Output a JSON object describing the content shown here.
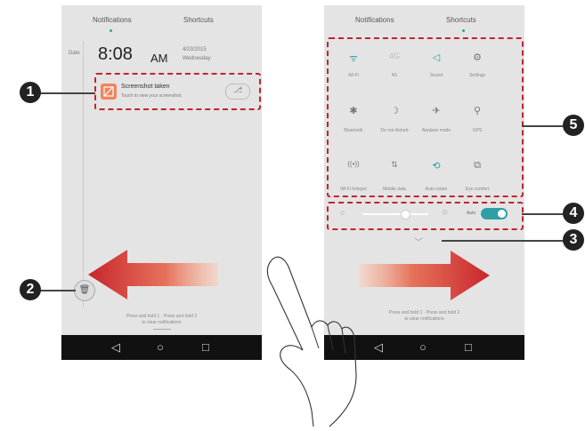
{
  "callouts": [
    "1",
    "2",
    "3",
    "4",
    "5"
  ],
  "left_screen": {
    "tabs": [
      "Notifications",
      "Shortcuts"
    ],
    "date_label": "Date",
    "time": "8:08",
    "ampm": "AM",
    "date_text": "4/23/2015",
    "weekday": "Wednesday",
    "notification_title": "Screenshot taken",
    "notification_text": "Touch to view your screenshot.",
    "bottom_text_1": "Press and hold 1 · Press and hold 2",
    "bottom_text_2": "to clear notifications"
  },
  "right_screen": {
    "tabs": [
      "Notifications",
      "Shortcuts"
    ],
    "row1": [
      {
        "icon": "wifi-icon",
        "glyph": "ᯤ",
        "label": "Wi-Fi"
      },
      {
        "icon": "4g-icon",
        "glyph": "4G",
        "label": "4G"
      },
      {
        "icon": "sound-icon",
        "glyph": "◁",
        "label": "Sound"
      },
      {
        "icon": "settings-icon",
        "glyph": "⚙",
        "label": "Settings"
      }
    ],
    "row2": [
      {
        "icon": "bluetooth-icon",
        "glyph": "✱",
        "label": "Bluetooth"
      },
      {
        "icon": "do-not-disturb-icon",
        "glyph": "☽",
        "label": "Do not disturb"
      },
      {
        "icon": "airplane-icon",
        "glyph": "✈",
        "label": "Airplane mode"
      },
      {
        "icon": "gps-icon",
        "glyph": "⚲",
        "label": "GPS"
      }
    ],
    "row3": [
      {
        "icon": "hotspot-icon",
        "glyph": "((•))",
        "label": "Wi-Fi hotspot"
      },
      {
        "icon": "mobile-data-icon",
        "glyph": "⇅",
        "label": "Mobile data"
      },
      {
        "icon": "auto-rotate-icon",
        "glyph": "⟲",
        "label": "Auto-rotate"
      },
      {
        "icon": "screenshot-icon",
        "glyph": "⧉",
        "label": "Eye comfort"
      }
    ],
    "brightness_auto": "Auto",
    "bottom_text_1": "Press and hold 1 · Press and hold 2",
    "bottom_text_2": "to clear notifications"
  },
  "colors": {
    "accent": "#2f9fa6",
    "arrow_red": "#c0252b",
    "dash_red": "#c0252b"
  }
}
